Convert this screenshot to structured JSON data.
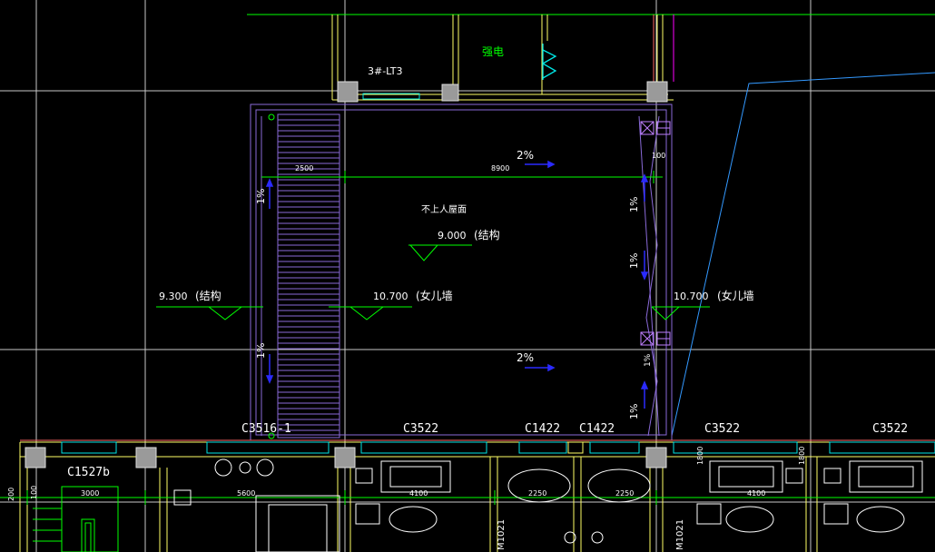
{
  "drawing": {
    "lift_label": "3#-LT3",
    "electric_label": "强电",
    "roof_note": "不上人屋面",
    "slopes": [
      "2%",
      "2%",
      "1%",
      "1%",
      "1%",
      "1%",
      "1%",
      "1%"
    ],
    "levels": [
      {
        "value": "9.000",
        "note": "(结构"
      },
      {
        "value": "9.300",
        "note": "(结构"
      },
      {
        "value": "10.700",
        "note": "(女儿墙"
      },
      {
        "value": "10.700",
        "note": "(女儿墙"
      }
    ],
    "windows": [
      "C3516-1",
      "C3522",
      "C1422",
      "C1422",
      "C3522",
      "C3522",
      "C1527b"
    ],
    "doors": [
      "M1021",
      "M1021"
    ],
    "dimensions": [
      "2500",
      "8900",
      "100",
      "3000",
      "5600",
      "4100",
      "2250",
      "2250",
      "4100",
      "200",
      "100",
      "1800",
      "1800"
    ]
  },
  "colors": {
    "background": "#000000",
    "grid": "#c8c8c8",
    "wall": "#ffff66",
    "dimension": "#00ff00",
    "text": "#ffffff",
    "slope": "#2a2aff",
    "window": "#00e6e6",
    "magenta": "#ff00ff",
    "purple": "#8a6ad8",
    "column": "#a0a0a0",
    "furniture": "#ffffff",
    "site_line": "#3399ff"
  }
}
